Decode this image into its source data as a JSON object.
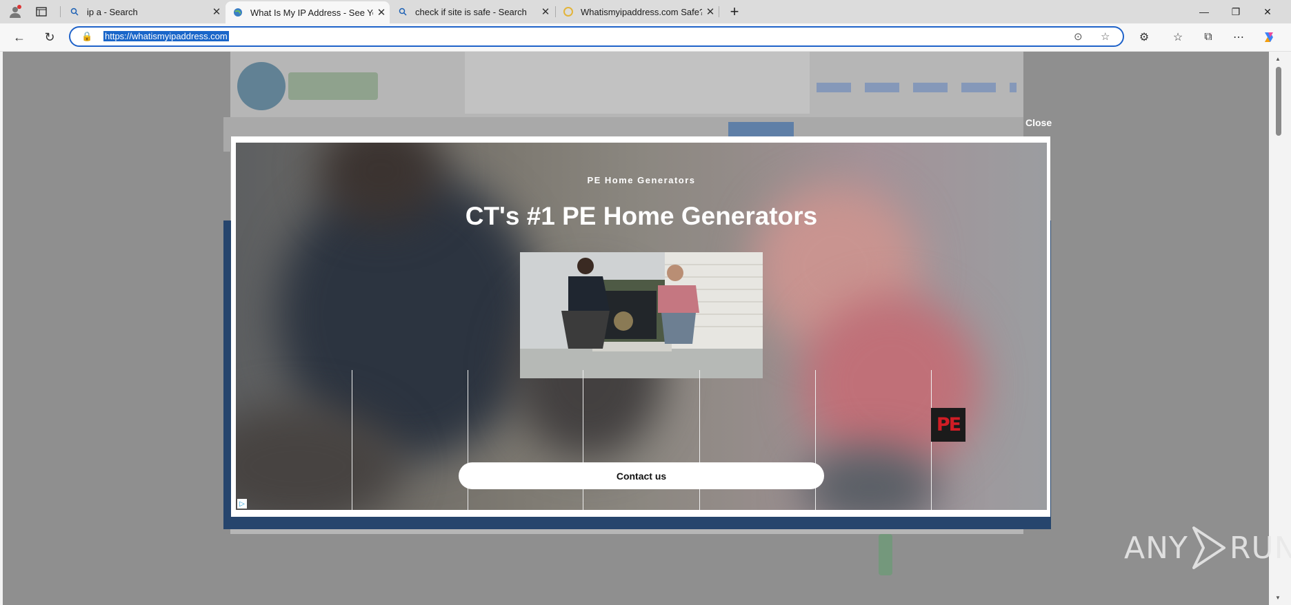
{
  "browser": {
    "tabs": [
      {
        "title": "ip a - Search",
        "icon": "search-icon",
        "active": false
      },
      {
        "title": "What Is My IP Address - See Your",
        "icon": "globe-icon",
        "active": true
      },
      {
        "title": "check if site is safe - Search",
        "icon": "search-icon",
        "active": false
      },
      {
        "title": "Whatismyipaddress.com Safe? Ch",
        "icon": "web-icon",
        "active": false
      }
    ],
    "address_bar": {
      "url": "https://whatismyipaddress.com"
    }
  },
  "ad": {
    "close_label": "Close",
    "sponsor": "PE Home Generators",
    "headline": "CT's #1 PE Home Generators",
    "logo_text": "PE",
    "cta_label": "Contact us"
  },
  "watermark": {
    "text": "ANY",
    "text2": "RUN"
  },
  "colors": {
    "accent": "#1e62c9",
    "logo_red": "#d01d25"
  }
}
